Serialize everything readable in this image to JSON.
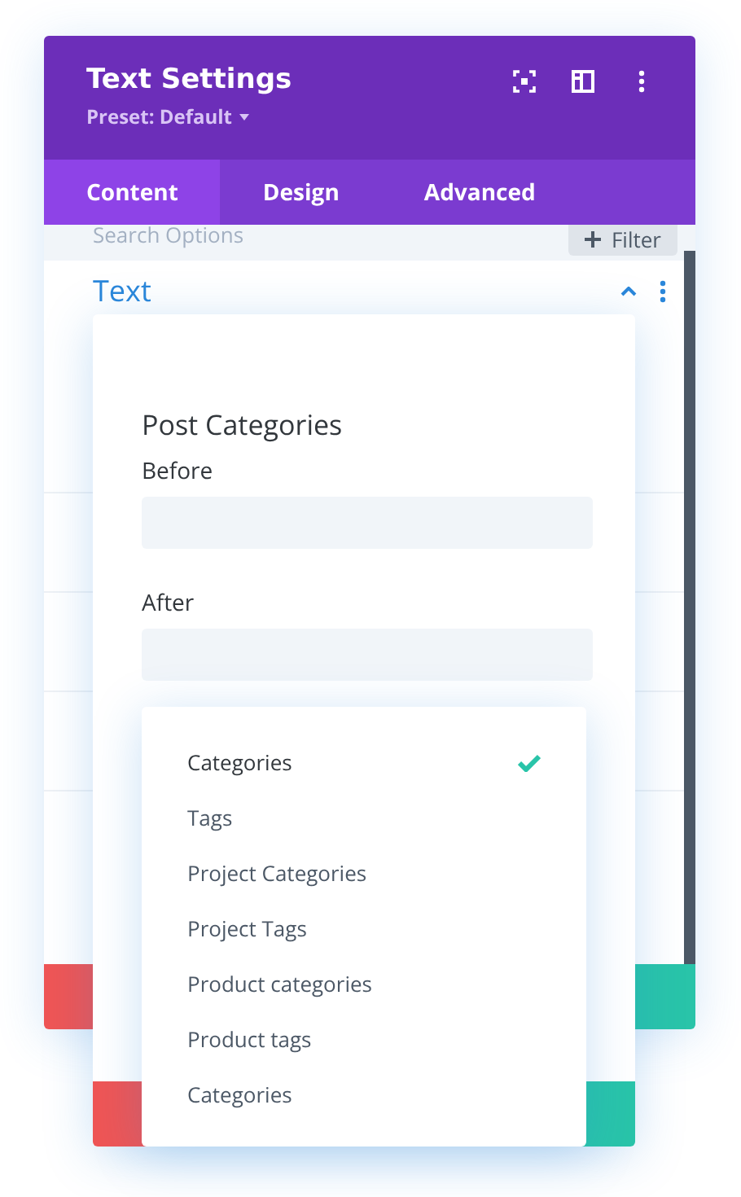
{
  "window": {
    "title": "Text Settings",
    "preset": "Preset: Default"
  },
  "tabs": [
    {
      "label": "Content",
      "selected": true
    },
    {
      "label": "Design",
      "selected": false
    },
    {
      "label": "Advanced",
      "selected": false
    }
  ],
  "search": {
    "placeholder": "Search Options",
    "filter_button": "Filter"
  },
  "section": {
    "title": "Text",
    "expanded": true
  },
  "modal": {
    "title": "Post Categories",
    "fields": [
      {
        "label": "Before"
      },
      {
        "label": "After"
      }
    ]
  },
  "dropdown": {
    "options": [
      {
        "label": "Categories",
        "selected": true
      },
      {
        "label": "Tags",
        "selected": false
      },
      {
        "label": "Project Categories",
        "selected": false
      },
      {
        "label": "Project Tags",
        "selected": false
      },
      {
        "label": "Product categories",
        "selected": false
      },
      {
        "label": "Product tags",
        "selected": false
      },
      {
        "label": "Categories",
        "selected": false
      }
    ]
  }
}
